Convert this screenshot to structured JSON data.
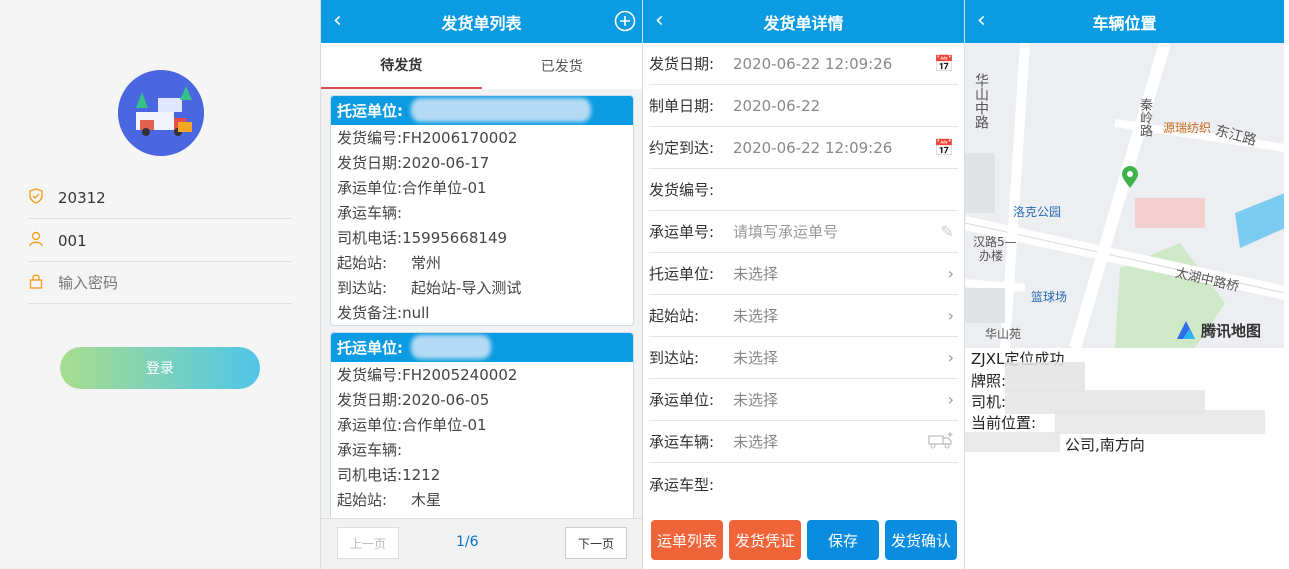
{
  "login": {
    "username": "20312",
    "code": "001",
    "password_placeholder": "输入密码",
    "login_label": "登录"
  },
  "list": {
    "title": "发货单列表",
    "tabs": [
      "待发货",
      "已发货"
    ],
    "cards": [
      {
        "header": "托运单位:",
        "rows": [
          {
            "k": "发货编号:",
            "v": "FH2006170002"
          },
          {
            "k": "发货日期:",
            "v": "2020-06-17"
          },
          {
            "k": "承运单位:",
            "v": "合作单位-01"
          },
          {
            "k": "承运车辆:",
            "v": ""
          },
          {
            "k": "司机电话:",
            "v": "15995668149"
          },
          {
            "k": "起始站:",
            "v": "常州"
          },
          {
            "k": "到达站:",
            "v": "起始站-导入测试"
          },
          {
            "k": "发货备注:",
            "v": "null"
          }
        ]
      },
      {
        "header": "托运单位:",
        "rows": [
          {
            "k": "发货编号:",
            "v": "FH2005240002"
          },
          {
            "k": "发货日期:",
            "v": "2020-06-05"
          },
          {
            "k": "承运单位:",
            "v": "合作单位-01"
          },
          {
            "k": "承运车辆:",
            "v": ""
          },
          {
            "k": "司机电话:",
            "v": "1212"
          },
          {
            "k": "起始站:",
            "v": "木星"
          }
        ]
      }
    ],
    "prev_label": "上一页",
    "page": "1/6",
    "next_label": "下一页"
  },
  "detail": {
    "title": "发货单详情",
    "rows": [
      {
        "k": "发货日期:",
        "v": "2020-06-22 12:09:26",
        "icon": "calendar-icon"
      },
      {
        "k": "制单日期:",
        "v": "2020-06-22",
        "icon": ""
      },
      {
        "k": "约定到达:",
        "v": "2020-06-22 12:09:26",
        "icon": "calendar-icon"
      },
      {
        "k": "发货编号:",
        "v": "",
        "icon": ""
      },
      {
        "k": "承运单号:",
        "v": "请填写承运单号",
        "icon": "pencil-icon"
      },
      {
        "k": "托运单位:",
        "v": "未选择",
        "icon": "chevron-right-icon"
      },
      {
        "k": "起始站:",
        "v": "未选择",
        "icon": "chevron-right-icon"
      },
      {
        "k": "到达站:",
        "v": "未选择",
        "icon": "chevron-right-icon"
      },
      {
        "k": "承运单位:",
        "v": "未选择",
        "icon": "chevron-right-icon"
      },
      {
        "k": "承运车辆:",
        "v": "未选择",
        "icon": "truck-add-icon"
      },
      {
        "k": "承运车型:",
        "v": "",
        "icon": ""
      }
    ],
    "buttons": [
      {
        "label": "运单列表",
        "color": "#f0643a"
      },
      {
        "label": "发货凭证",
        "color": "#f0643a"
      },
      {
        "label": "保存",
        "color": "#0a8de0"
      },
      {
        "label": "发货确认",
        "color": "#0a8de0"
      }
    ]
  },
  "map": {
    "title": "车辆位置",
    "labels": {
      "road1": "华山中路",
      "road2": "秦岭路",
      "road3": "东江路",
      "road4": "太湖中路桥",
      "road5": "汉路5—",
      "road6": "办楼",
      "poi1": "源瑞纺织",
      "poi2": "洛克公园",
      "poi3": "篮球场",
      "poi4": "华山苑",
      "brand": "腾讯地图"
    },
    "info": [
      "ZJXL定位成功",
      "牌照:",
      "司机:",
      "当前位置:",
      "公司,南方向"
    ]
  }
}
